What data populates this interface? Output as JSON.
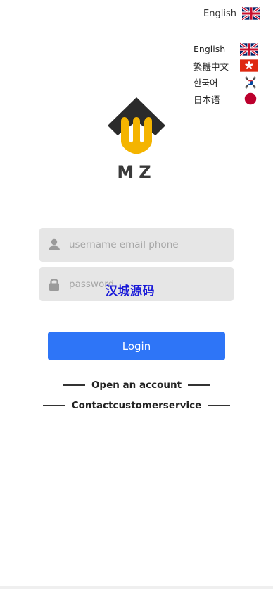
{
  "language_switcher": {
    "current_label": "English",
    "current_flag_icon": "uk-flag-icon",
    "options": [
      {
        "label": "English",
        "flag_icon": "uk-flag-icon"
      },
      {
        "label": "繁體中文",
        "flag_icon": "hong-kong-flag-icon"
      },
      {
        "label": "한국어",
        "flag_icon": "south-korea-flag-icon"
      },
      {
        "label": "日本语",
        "flag_icon": "japan-flag-icon"
      }
    ]
  },
  "brand": {
    "name": "MZ",
    "colors": {
      "mark": "#f4b400",
      "cap": "#2b2b2b"
    }
  },
  "login_form": {
    "username_placeholder": "username email phone",
    "username_value": "",
    "password_placeholder": "password",
    "password_value": "",
    "submit_label": "Login",
    "accent_color": "#2e75f7"
  },
  "links": {
    "open_account": "Open an account",
    "contact_service": "Contactcustomerservice"
  },
  "watermark": "汉城源码"
}
